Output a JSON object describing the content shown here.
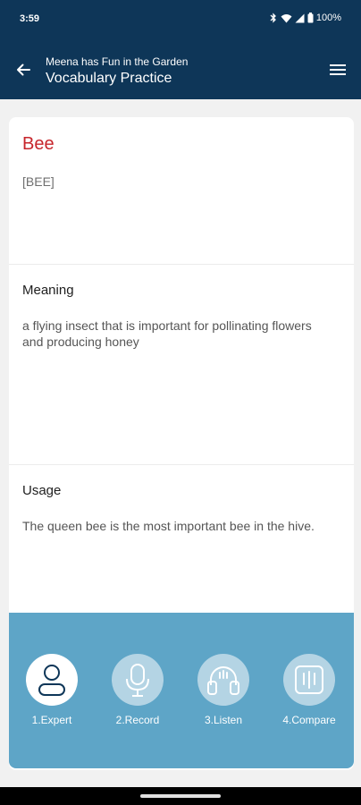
{
  "status": {
    "time": "3:59",
    "battery": "100%"
  },
  "appbar": {
    "subtitle": "Meena has Fun in the Garden",
    "title": "Vocabulary Practice"
  },
  "word": {
    "text": "Bee",
    "phonetic": "[BEE]"
  },
  "meaning": {
    "title": "Meaning",
    "text": "a flying insect that is important for pollinating flowers and producing honey"
  },
  "usage": {
    "title": "Usage",
    "text": "The queen bee is the most important bee in the hive."
  },
  "actions": [
    {
      "label": "1.Expert",
      "icon": "person-icon",
      "active": true
    },
    {
      "label": "2.Record",
      "icon": "microphone-icon",
      "active": false
    },
    {
      "label": "3.Listen",
      "icon": "headphones-icon",
      "active": false
    },
    {
      "label": "4.Compare",
      "icon": "waveform-icon",
      "active": false
    }
  ],
  "colors": {
    "header": "#0e3658",
    "word": "#c7252b",
    "action_panel": "#5ea5c7"
  }
}
